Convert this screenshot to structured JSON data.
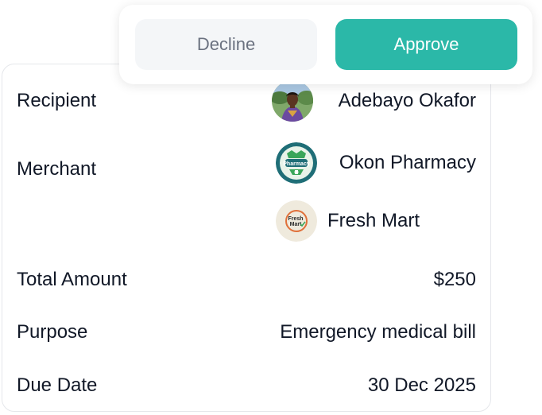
{
  "actions": {
    "decline_label": "Decline",
    "approve_label": "Approve"
  },
  "details": {
    "recipient": {
      "label": "Recipient",
      "name": "Adebayo Okafor"
    },
    "merchant": {
      "label": "Merchant",
      "items": [
        {
          "name": "Okon Pharmacy",
          "logo_text": "Pharmacy"
        },
        {
          "name": "Fresh Mart",
          "logo_text_line1": "Fresh",
          "logo_text_line2": "Mart"
        }
      ]
    },
    "total_amount": {
      "label": "Total Amount",
      "value": "$250"
    },
    "purpose": {
      "label": "Purpose",
      "value": "Emergency medical bill"
    },
    "due_date": {
      "label": "Due Date",
      "value": "30 Dec 2025"
    }
  },
  "colors": {
    "approve_bg": "#2bb8a8",
    "decline_bg": "#f4f6f8",
    "decline_text": "#6b7280",
    "text": "#111827"
  },
  "icons": {
    "recipient_avatar": "person-photo",
    "okon_pharmacy_logo": "pharmacy-logo-icon",
    "fresh_mart_logo": "fresh-mart-logo-icon"
  }
}
